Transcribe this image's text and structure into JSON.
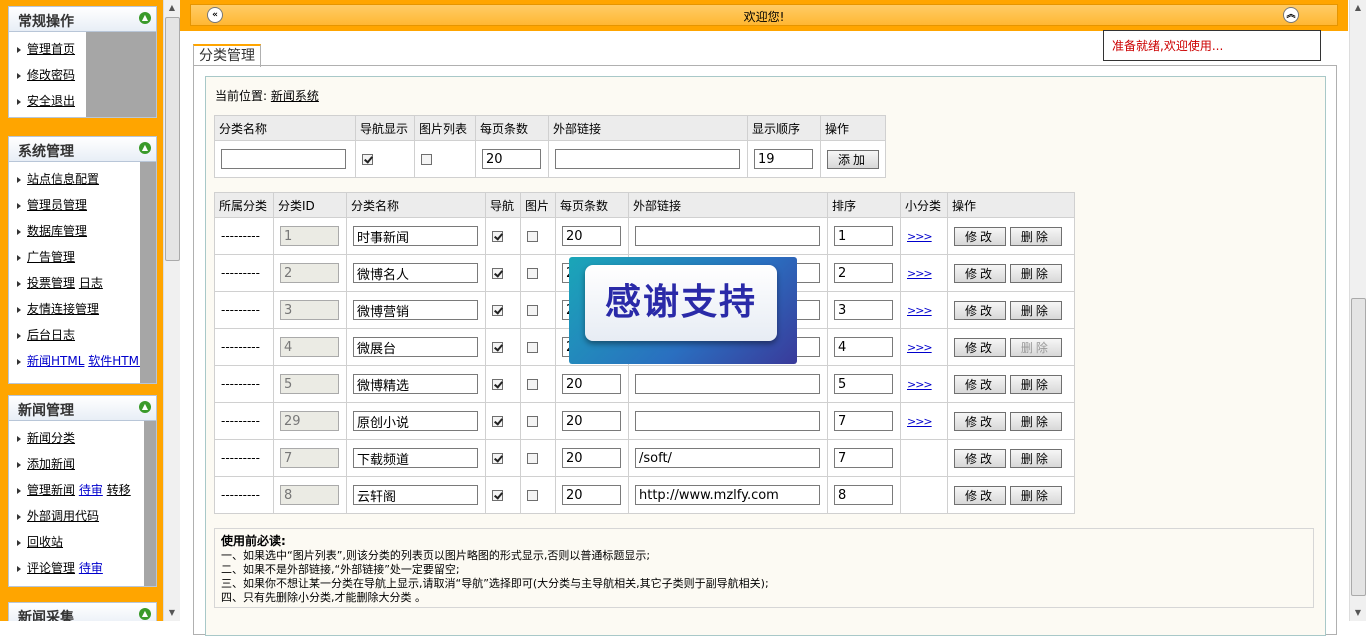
{
  "sidebar": {
    "panels": [
      {
        "title": "常规操作",
        "items": [
          "管理首页",
          "修改密码",
          "安全退出"
        ]
      },
      {
        "title": "系统管理",
        "items": [
          "站点信息配置",
          "管理员管理",
          "数据库管理",
          "广告管理",
          "投票管理",
          "日志",
          "友情连接管理",
          "后台日志",
          "新闻HTML",
          "软件HTML"
        ]
      },
      {
        "title": "新闻管理",
        "items": [
          "新闻分类",
          "添加新闻",
          "管理新闻",
          "待审",
          "转移",
          "外部调用代码",
          "回收站",
          "评论管理",
          "待审"
        ]
      },
      {
        "title": "新闻采集"
      }
    ]
  },
  "topbar": {
    "welcome": "欢迎您!"
  },
  "status": "准备就绪,欢迎使用...",
  "tab": "分类管理",
  "crumb": {
    "label": "当前位置:",
    "link": "新闻系统"
  },
  "add_form": {
    "headers": [
      "分类名称",
      "导航显示",
      "图片列表",
      "每页条数",
      "外部链接",
      "显示顺序",
      "操作"
    ],
    "name": "",
    "nav": true,
    "pic": false,
    "per_page": "20",
    "link": "",
    "order": "19",
    "add_button": "添加"
  },
  "list": {
    "headers": [
      "所属分类",
      "分类ID",
      "分类名称",
      "导航",
      "图片",
      "每页条数",
      "外部链接",
      "排序",
      "小分类",
      "操作"
    ],
    "more": ">>>",
    "edit": "修改",
    "delete": "删除",
    "rows": [
      {
        "parent": "---------",
        "id": "1",
        "name": "时事新闻",
        "nav": true,
        "pic": false,
        "per": "20",
        "link": "",
        "order": "1",
        "sub": true,
        "del_disabled": false
      },
      {
        "parent": "---------",
        "id": "2",
        "name": "微博名人",
        "nav": true,
        "pic": false,
        "per": "20",
        "link": "",
        "order": "2",
        "sub": true,
        "del_disabled": false
      },
      {
        "parent": "---------",
        "id": "3",
        "name": "微博营销",
        "nav": true,
        "pic": false,
        "per": "20",
        "link": "",
        "order": "3",
        "sub": true,
        "del_disabled": false
      },
      {
        "parent": "---------",
        "id": "4",
        "name": "微展台",
        "nav": true,
        "pic": false,
        "per": "20",
        "link": "",
        "order": "4",
        "sub": true,
        "del_disabled": true
      },
      {
        "parent": "---------",
        "id": "5",
        "name": "微博精选",
        "nav": true,
        "pic": false,
        "per": "20",
        "link": "",
        "order": "5",
        "sub": true,
        "del_disabled": false
      },
      {
        "parent": "---------",
        "id": "29",
        "name": "原创小说",
        "nav": true,
        "pic": false,
        "per": "20",
        "link": "",
        "order": "7",
        "sub": true,
        "del_disabled": false
      },
      {
        "parent": "---------",
        "id": "7",
        "name": "下载频道",
        "nav": true,
        "pic": false,
        "per": "20",
        "link": "/soft/",
        "order": "7",
        "sub": false,
        "del_disabled": false
      },
      {
        "parent": "---------",
        "id": "8",
        "name": "云轩阁",
        "nav": true,
        "pic": false,
        "per": "20",
        "link": "http://www.mzlfy.com",
        "order": "8",
        "sub": false,
        "del_disabled": false
      }
    ]
  },
  "notes": {
    "title": "使用前必读:",
    "lines": [
      "一、如果选中“图片列表”,则该分类的列表页以图片略图的形式显示,否则以普通标题显示;",
      "二、如果不是外部链接,“外部链接”处一定要留空;",
      "三、如果你不想让某一分类在导航上显示,请取消“导航”选择即可(大分类与主导航相关,其它子类则于副导航相关);",
      "四、只有先删除小分类,才能删除大分类 。"
    ]
  },
  "overlay": {
    "text": "感谢支持"
  }
}
